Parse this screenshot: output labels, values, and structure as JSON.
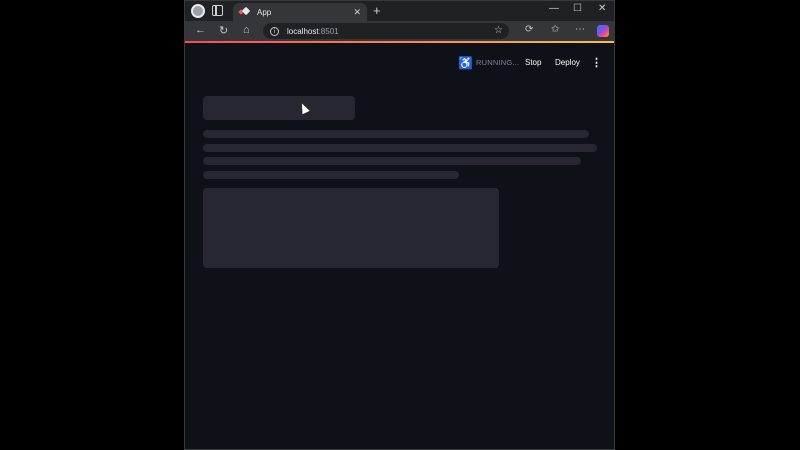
{
  "browser": {
    "tab": {
      "title": "App"
    },
    "address": {
      "host": "localhost",
      "port": ":8501"
    }
  },
  "app": {
    "header": {
      "status": "RUNNING...",
      "stop_label": "Stop",
      "deploy_label": "Deploy"
    }
  },
  "colors": {
    "page_bg": "#0e1117",
    "skeleton": "#262730",
    "accent_start": "#ff4b4b",
    "accent_end": "#ffbd45"
  },
  "icons": [
    "profile-icon",
    "tabs-icon",
    "close-icon",
    "new-tab-icon",
    "minimize-icon",
    "maximize-icon",
    "window-close-icon",
    "back-icon",
    "reload-icon",
    "home-icon",
    "info-icon",
    "star-icon",
    "extensions-icon",
    "favorites-icon",
    "more-icon",
    "copilot-icon",
    "running-man-icon",
    "menu-icon"
  ]
}
